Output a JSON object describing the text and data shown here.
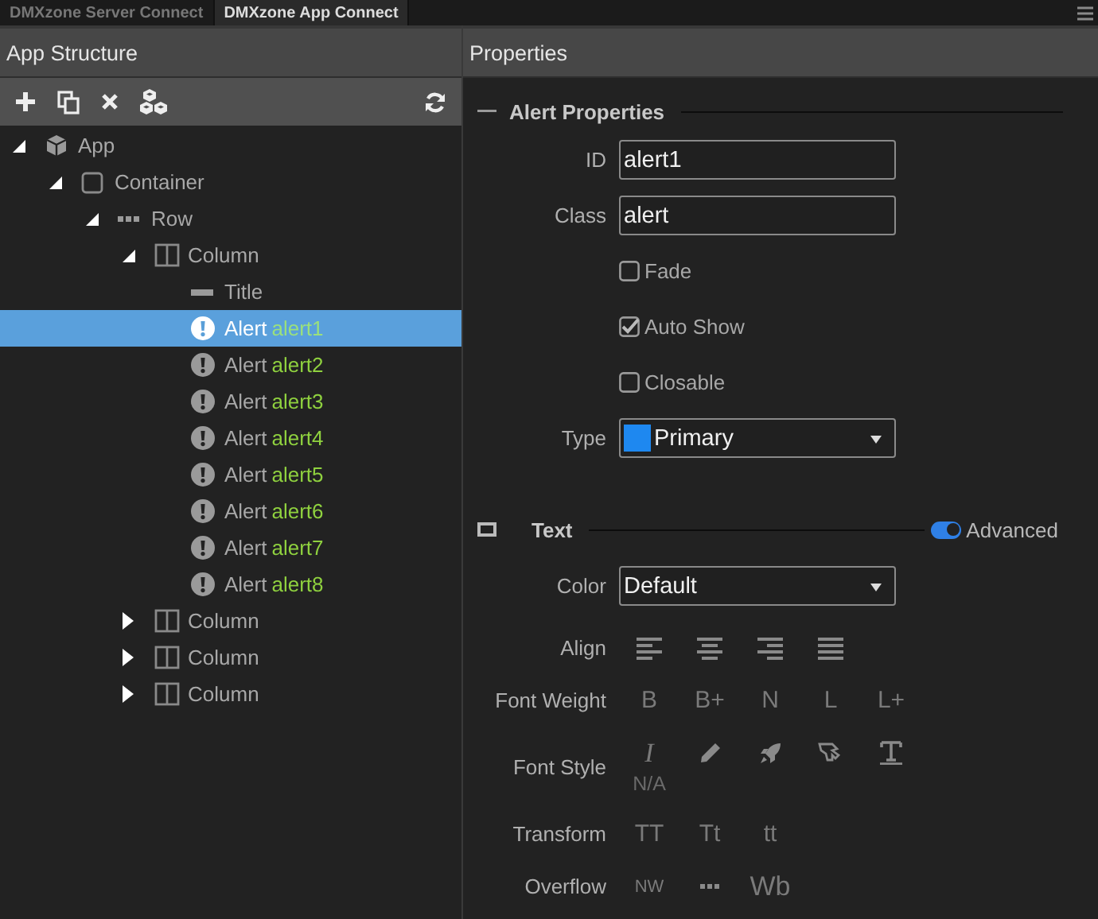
{
  "tabs": [
    {
      "label": "DMXzone Server Connect",
      "selected": false
    },
    {
      "label": "DMXzone App Connect",
      "selected": true
    }
  ],
  "app_structure": {
    "title": "App Structure",
    "tree": [
      {
        "kind": "app",
        "label": "App",
        "expanded": true,
        "selected": false,
        "children": [
          {
            "kind": "container",
            "label": "Container",
            "expanded": true,
            "selected": false,
            "children": [
              {
                "kind": "row",
                "label": "Row",
                "expanded": true,
                "selected": false,
                "children": [
                  {
                    "kind": "column",
                    "label": "Column",
                    "expanded": true,
                    "selected": false,
                    "children": [
                      {
                        "kind": "title",
                        "label": "Title",
                        "selected": false
                      },
                      {
                        "kind": "alert",
                        "label": "Alert",
                        "id": "alert1",
                        "selected": true
                      },
                      {
                        "kind": "alert",
                        "label": "Alert",
                        "id": "alert2",
                        "selected": false
                      },
                      {
                        "kind": "alert",
                        "label": "Alert",
                        "id": "alert3",
                        "selected": false
                      },
                      {
                        "kind": "alert",
                        "label": "Alert",
                        "id": "alert4",
                        "selected": false
                      },
                      {
                        "kind": "alert",
                        "label": "Alert",
                        "id": "alert5",
                        "selected": false
                      },
                      {
                        "kind": "alert",
                        "label": "Alert",
                        "id": "alert6",
                        "selected": false
                      },
                      {
                        "kind": "alert",
                        "label": "Alert",
                        "id": "alert7",
                        "selected": false
                      },
                      {
                        "kind": "alert",
                        "label": "Alert",
                        "id": "alert8",
                        "selected": false
                      }
                    ]
                  },
                  {
                    "kind": "column",
                    "label": "Column",
                    "expanded": false,
                    "selected": false
                  },
                  {
                    "kind": "column",
                    "label": "Column",
                    "expanded": false,
                    "selected": false
                  },
                  {
                    "kind": "column",
                    "label": "Column",
                    "expanded": false,
                    "selected": false
                  }
                ]
              }
            ]
          }
        ]
      }
    ]
  },
  "properties": {
    "title": "Properties",
    "alert_section": {
      "title": "Alert Properties",
      "fields": [
        {
          "kind": "text",
          "label": "ID",
          "value": "alert1"
        },
        {
          "kind": "text",
          "label": "Class",
          "value": "alert"
        },
        {
          "kind": "checkbox",
          "label": "Fade",
          "checked": false
        },
        {
          "kind": "checkbox",
          "label": "Auto Show",
          "checked": true
        },
        {
          "kind": "checkbox",
          "label": "Closable",
          "checked": false
        },
        {
          "kind": "select",
          "label": "Type",
          "value": "Primary",
          "color": "#1e88f0"
        }
      ]
    },
    "text_section": {
      "title": "Text",
      "advanced": {
        "label": "Advanced",
        "on": true
      },
      "fields": [
        {
          "kind": "select",
          "label": "Color",
          "value": "Default"
        },
        {
          "kind": "buttons",
          "label": "Align",
          "options": [
            {
              "kind": "align-left"
            },
            {
              "kind": "align-center"
            },
            {
              "kind": "align-right"
            },
            {
              "kind": "align-justify"
            }
          ]
        },
        {
          "kind": "buttons",
          "label": "Font Weight",
          "options": [
            {
              "kind": "text",
              "label": "B"
            },
            {
              "kind": "text",
              "label": "B+"
            },
            {
              "kind": "text",
              "label": "N"
            },
            {
              "kind": "text",
              "label": "L"
            },
            {
              "kind": "text",
              "label": "L+"
            }
          ]
        },
        {
          "kind": "buttons",
          "label": "Font Style",
          "options": [
            {
              "kind": "italic",
              "label": "I"
            },
            {
              "kind": "pencil"
            },
            {
              "kind": "rocket"
            },
            {
              "kind": "hand"
            },
            {
              "kind": "text-t"
            }
          ],
          "note": "N/A"
        },
        {
          "kind": "buttons",
          "label": "Transform",
          "options": [
            {
              "kind": "text",
              "label": "TT"
            },
            {
              "kind": "text",
              "label": "Tt"
            },
            {
              "kind": "text",
              "label": "tt"
            }
          ]
        },
        {
          "kind": "buttons",
          "label": "Overflow",
          "options": [
            {
              "kind": "small",
              "label": "NW"
            },
            {
              "kind": "ellipsis"
            },
            {
              "kind": "large",
              "label": "Wb"
            }
          ]
        }
      ]
    }
  }
}
